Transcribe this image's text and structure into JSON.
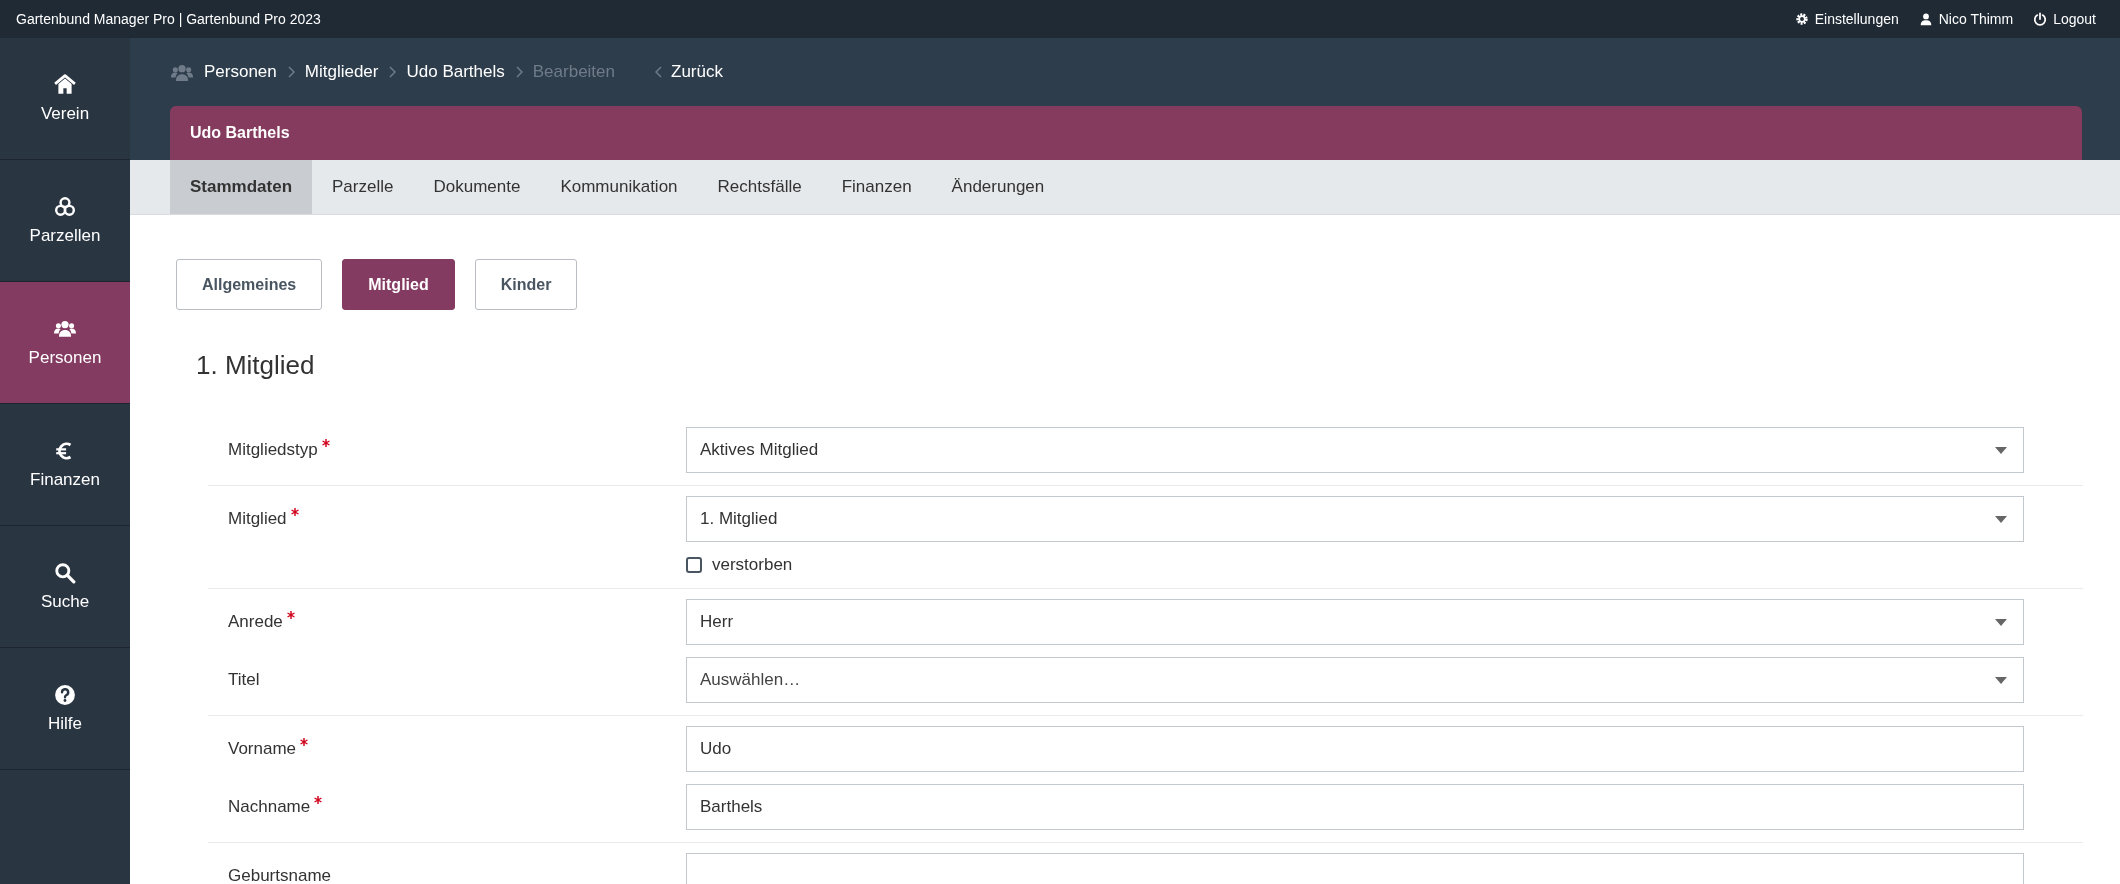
{
  "top_bar": {
    "title": "Gartenbund Manager Pro | Gartenbund Pro 2023",
    "links": [
      {
        "label": "Einstellungen"
      },
      {
        "label": "Nico Thimm"
      },
      {
        "label": "Logout"
      }
    ]
  },
  "sidebar": {
    "items": [
      {
        "label": "Verein",
        "selected": false
      },
      {
        "label": "Parzellen",
        "selected": false
      },
      {
        "label": "Personen",
        "selected": true
      },
      {
        "label": "Finanzen",
        "selected": false
      },
      {
        "label": "Suche",
        "selected": false
      },
      {
        "label": "Hilfe",
        "selected": false
      }
    ]
  },
  "breadcrumb": {
    "items": [
      {
        "label": "Personen",
        "current": false
      },
      {
        "label": "Mitglieder",
        "current": false
      },
      {
        "label": "Udo Barthels",
        "current": false
      },
      {
        "label": "Bearbeiten",
        "current": true
      }
    ],
    "back": "Zurück"
  },
  "record_title": "Udo Barthels",
  "tabs": [
    {
      "label": "Stammdaten",
      "selected": true
    },
    {
      "label": "Parzelle",
      "selected": false
    },
    {
      "label": "Dokumente",
      "selected": false
    },
    {
      "label": "Kommunikation",
      "selected": false
    },
    {
      "label": "Rechtsfälle",
      "selected": false
    },
    {
      "label": "Finanzen",
      "selected": false
    },
    {
      "label": "Änderungen",
      "selected": false
    }
  ],
  "sections": [
    {
      "label": "Allgemeines",
      "selected": false
    },
    {
      "label": "Mitglied",
      "selected": true
    },
    {
      "label": "Kinder",
      "selected": false
    }
  ],
  "heading": "1. Mitglied",
  "form_groups": [
    {
      "fields": [
        {
          "kind": "select",
          "label": "Mitgliedstyp",
          "required": true,
          "value": "Aktives Mitglied"
        }
      ]
    },
    {
      "fields": [
        {
          "kind": "select",
          "label": "Mitglied",
          "required": true,
          "value": "1. Mitglied"
        },
        {
          "kind": "checkbox",
          "label": "verstorben",
          "checked": false
        }
      ]
    },
    {
      "fields": [
        {
          "kind": "select",
          "label": "Anrede",
          "required": true,
          "value": "Herr"
        },
        {
          "kind": "select",
          "label": "Titel",
          "required": false,
          "placeholder": "Auswählen…"
        }
      ]
    },
    {
      "fields": [
        {
          "kind": "text",
          "label": "Vorname",
          "required": true,
          "value": "Udo"
        },
        {
          "kind": "text",
          "label": "Nachname",
          "required": true,
          "value": "Barthels"
        }
      ]
    },
    {
      "fields": [
        {
          "kind": "text",
          "label": "Geburtsname",
          "required": false
        }
      ]
    }
  ]
}
